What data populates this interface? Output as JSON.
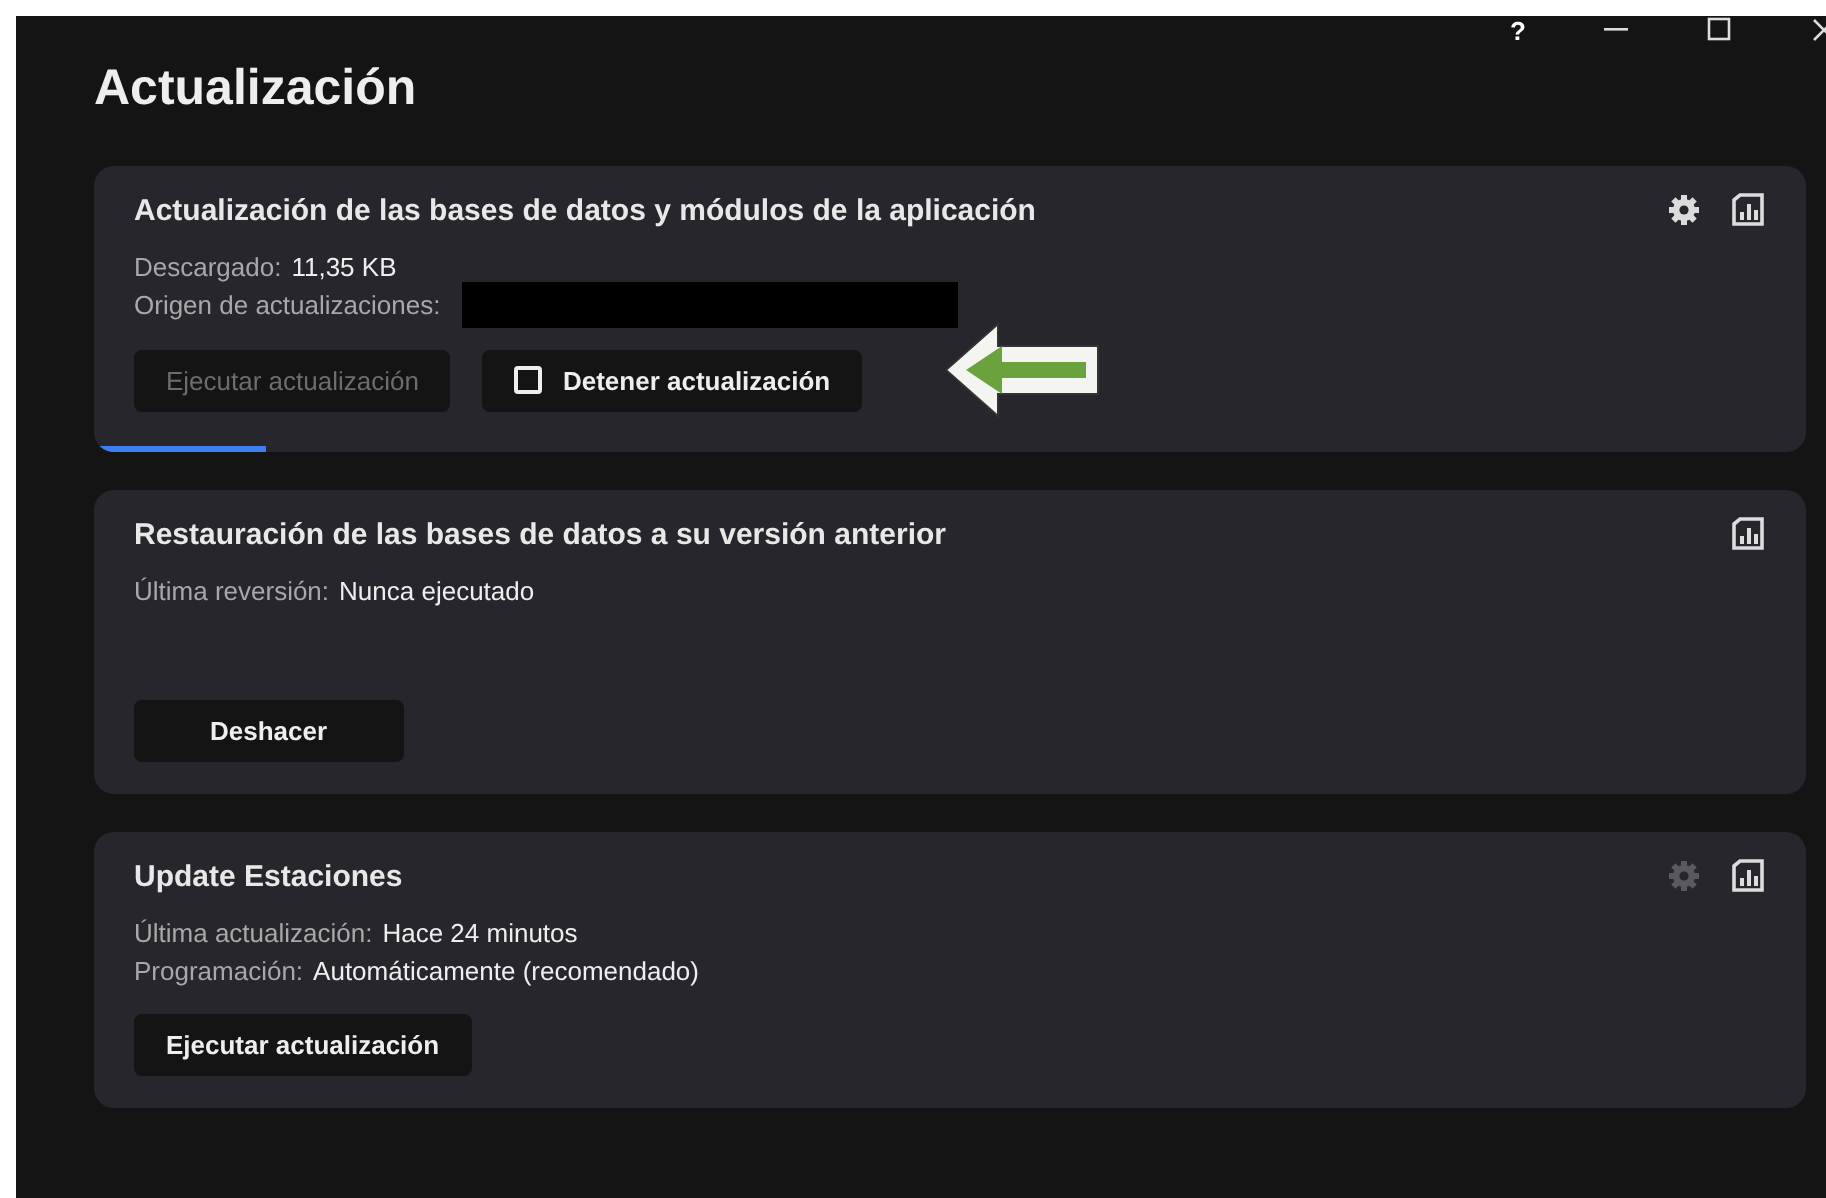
{
  "window": {
    "title": "Actualización",
    "help": "?"
  },
  "cards": [
    {
      "title": "Actualización de las bases de datos y módulos de la aplicación",
      "settings": {
        "disabled": false
      },
      "rows": [
        {
          "label": "Descargado:",
          "value": "11,35 KB"
        },
        {
          "label": "Origen de actualizaciones:",
          "redacted": true
        }
      ],
      "buttons": [
        {
          "label": "Ejecutar actualización",
          "disabled": true,
          "kind": "plain"
        },
        {
          "label": "Detener actualización",
          "disabled": false,
          "kind": "stop"
        }
      ],
      "progress": {
        "level": 0.1
      },
      "annotation": {
        "kind": "arrow"
      }
    },
    {
      "title": "Restauración de las bases de datos a su versión anterior",
      "rows": [
        {
          "label": "Última reversión:",
          "value": "Nunca ejecutado"
        }
      ],
      "buttons": [
        {
          "label": "Deshacer",
          "disabled": false,
          "kind": "wide"
        }
      ]
    },
    {
      "title": "Update Estaciones",
      "settings": {
        "disabled": true
      },
      "rows": [
        {
          "label": "Última actualización:",
          "value": "Hace 24 minutos"
        },
        {
          "label": "Programación:",
          "value": "Automáticamente (recomendado)"
        }
      ],
      "buttons": [
        {
          "label": "Ejecutar actualización",
          "disabled": false,
          "kind": "plain"
        }
      ]
    }
  ]
}
